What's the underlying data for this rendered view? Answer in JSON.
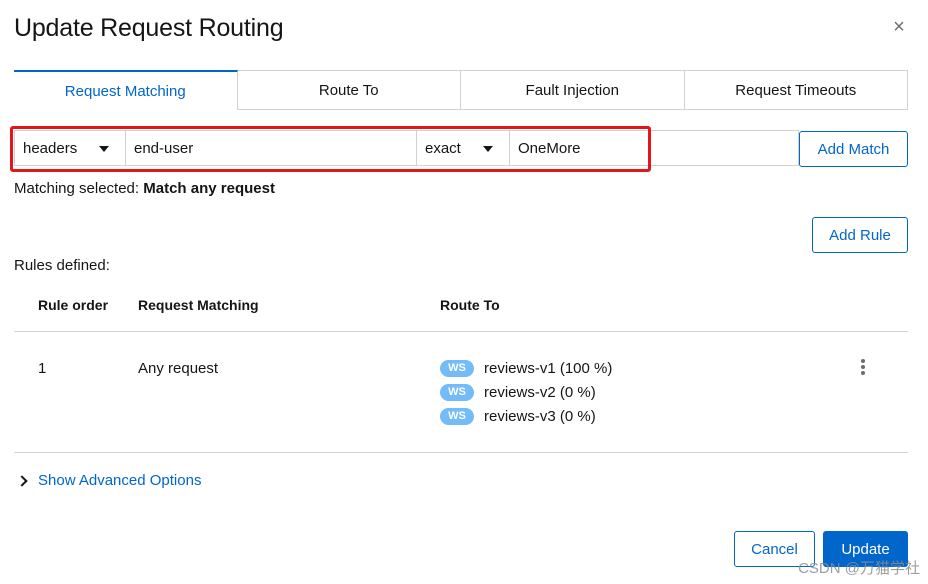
{
  "dialog": {
    "title": "Update Request Routing",
    "close_glyph": "×"
  },
  "tabs": [
    {
      "label": "Request Matching",
      "active": true
    },
    {
      "label": "Route To",
      "active": false
    },
    {
      "label": "Fault Injection",
      "active": false
    },
    {
      "label": "Request Timeouts",
      "active": false
    }
  ],
  "match": {
    "type_select": "headers",
    "header_name": "end-user",
    "operator_select": "exact",
    "value": "OneMore",
    "add_match_label": "Add Match"
  },
  "matching_selected": {
    "prefix": "Matching selected:",
    "value": "Match any request"
  },
  "add_rule_label": "Add Rule",
  "rules_defined_label": "Rules defined:",
  "table": {
    "headers": [
      "Rule order",
      "Request Matching",
      "Route To"
    ],
    "rows": [
      {
        "order": "1",
        "matching": "Any request",
        "routes": [
          {
            "badge": "WS",
            "text": "reviews-v1 (100 %)"
          },
          {
            "badge": "WS",
            "text": "reviews-v2 (0 %)"
          },
          {
            "badge": "WS",
            "text": "reviews-v3 (0 %)"
          }
        ]
      }
    ]
  },
  "advanced_options_label": "Show Advanced Options",
  "footer": {
    "cancel_label": "Cancel",
    "update_label": "Update"
  },
  "watermark": "CSDN @万猫学社",
  "icons": {
    "close": "close-icon",
    "caret": "caret-down-icon",
    "kebab": "kebab-icon",
    "chevron": "chevron-right-icon"
  },
  "colors": {
    "accent": "#0066cc",
    "highlight": "#e5161b",
    "badge": "#73bcf7",
    "border": "#d2d2d2"
  }
}
